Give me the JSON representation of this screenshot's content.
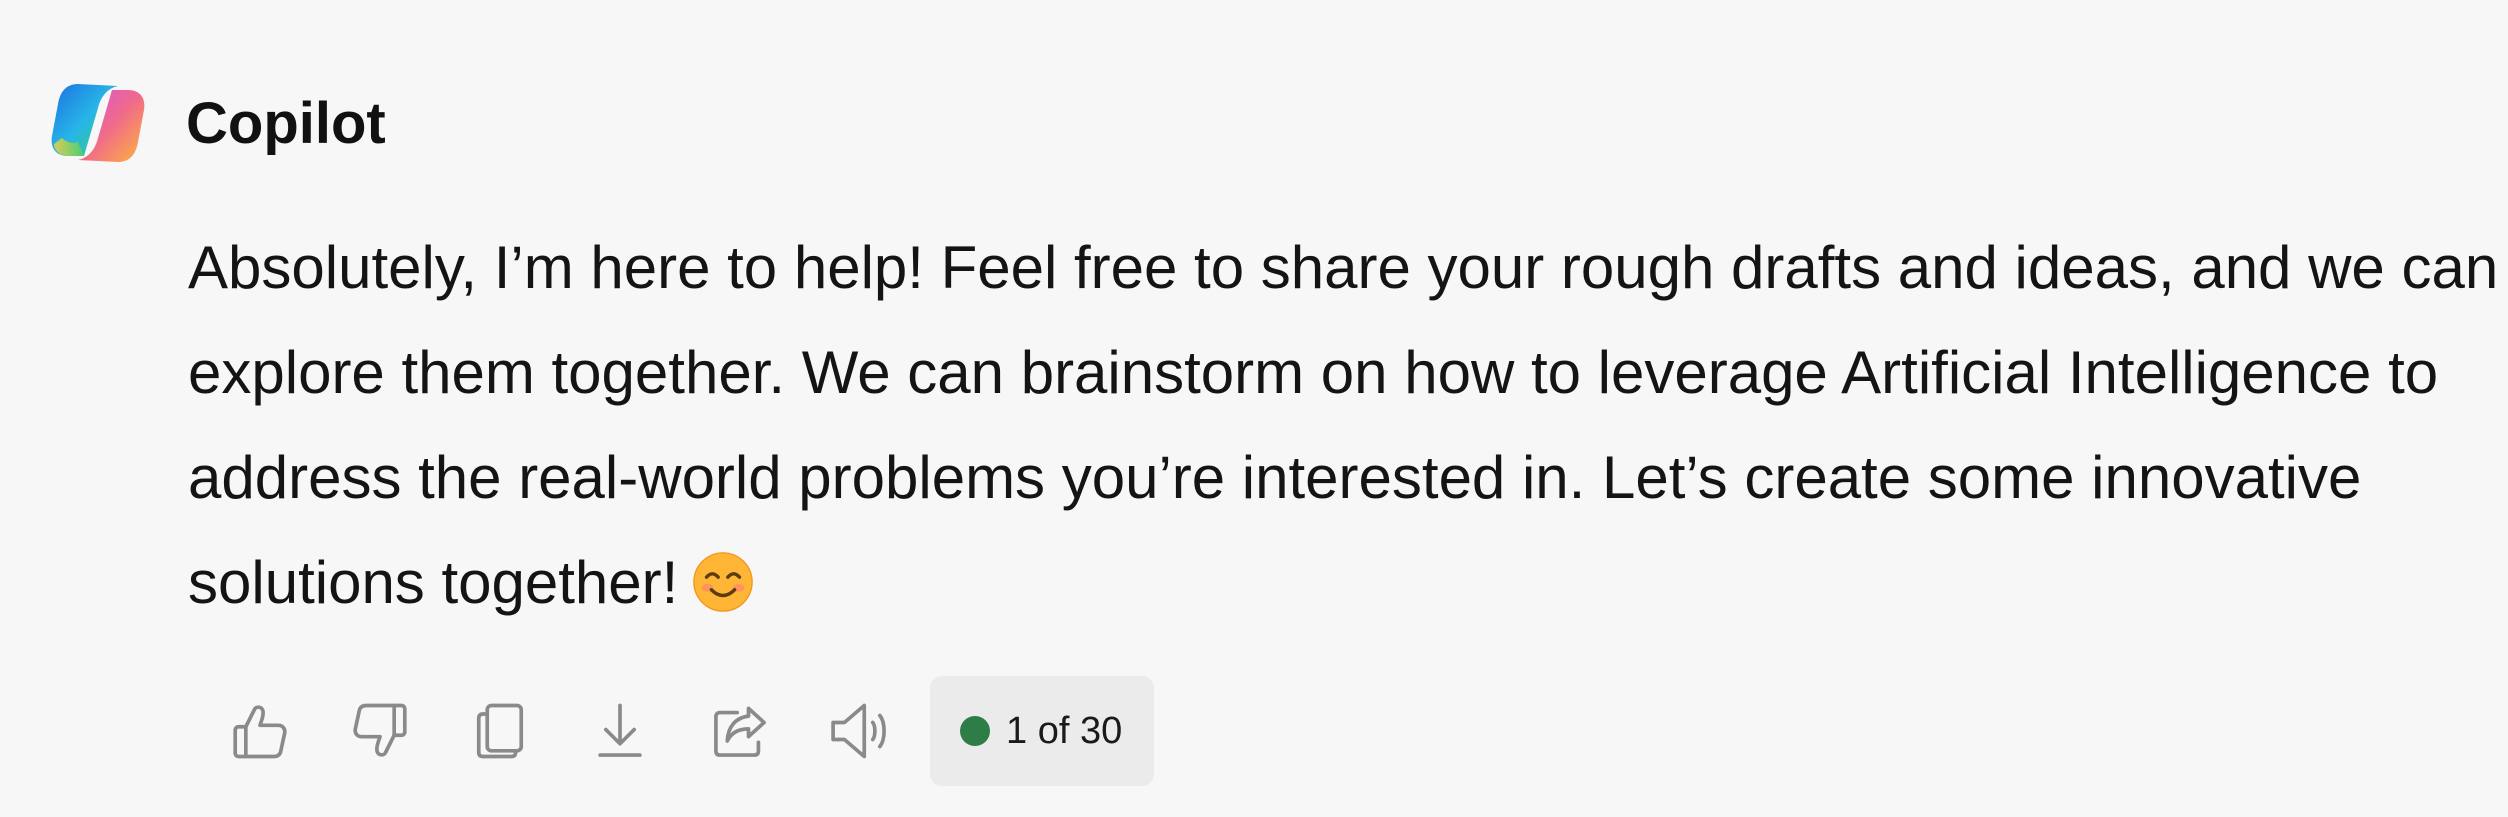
{
  "message": {
    "sender": "Copilot",
    "logo_icon": "copilot-logo-icon",
    "lines": [
      "Absolutely, I’m here to help! Feel free to share your rough drafts and ideas, and we can",
      "explore them together. We can brainstorm on how to leverage Artificial Intelligence to",
      "address the real-world problems you’re interested in. Let’s create some innovative",
      "solutions together!"
    ],
    "emoji": "smiling-face-emoji"
  },
  "actions": {
    "buttons": [
      {
        "name": "like-button",
        "icon": "thumbs-up-icon"
      },
      {
        "name": "dislike-button",
        "icon": "thumbs-down-icon"
      },
      {
        "name": "copy-button",
        "icon": "copy-icon"
      },
      {
        "name": "download-button",
        "icon": "download-icon"
      },
      {
        "name": "share-button",
        "icon": "share-icon"
      },
      {
        "name": "read-aloud-button",
        "icon": "speaker-icon"
      }
    ],
    "counter_label": "1 of 30",
    "counter_dot_color": "#2e7d46"
  },
  "colors": {
    "background": "#f7f7f7",
    "icon_stroke": "#8a8a8a",
    "counter_background": "#ebebeb"
  }
}
